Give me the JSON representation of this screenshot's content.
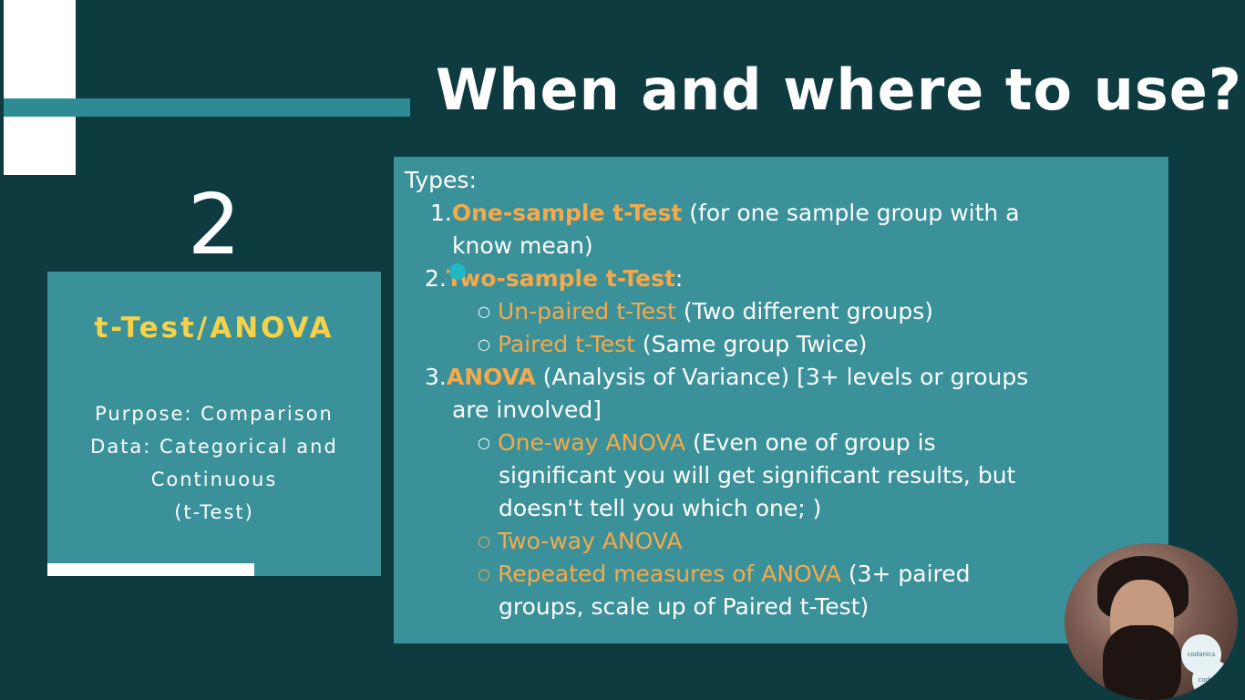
{
  "slide": {
    "title": "When and where to use?",
    "number": "2"
  },
  "card": {
    "heading": "t-Test/ANOVA",
    "lines": [
      "Purpose: Comparison",
      "Data: Categorical and",
      "Continuous",
      "(t-Test)"
    ]
  },
  "content": {
    "types_label": "Types:",
    "item1": {
      "num": "1.",
      "name": "One-sample t-Test",
      "desc": " (for one sample group with a",
      "desc2": "know mean)"
    },
    "item2": {
      "num": "2.",
      "name": "Two-sample t-Test",
      "colon": ":",
      "subs": [
        {
          "name": "Un-paired t-Test",
          "desc": " (Two different groups)"
        },
        {
          "name": "Paired t-Test",
          "desc": " (Same group Twice)"
        }
      ]
    },
    "item3": {
      "num": "3.",
      "name": "ANOVA",
      "desc": " (Analysis of Variance) [3+ levels or groups",
      "desc2": "are involved]",
      "subs": [
        {
          "name": "One-way ANOVA",
          "desc": " (Even one of group is",
          "desc2": "significant you will get significant results, but",
          "desc3": "doesn't tell you which one; )"
        },
        {
          "name": "Two-way ANOVA"
        },
        {
          "name": "Repeated measures of ANOVA",
          "desc": " (3+ paired",
          "desc2": "groups, scale up of Paired t-Test)"
        }
      ]
    },
    "bullet_char": "○"
  },
  "webcam": {
    "badge_text_1": "codanics",
    "badge_text_2": "codanics"
  },
  "colors": {
    "background": "#0d3b40",
    "panel": "#3a919a",
    "highlight": "#f5a94a",
    "heading_yellow": "#f5d24a"
  }
}
